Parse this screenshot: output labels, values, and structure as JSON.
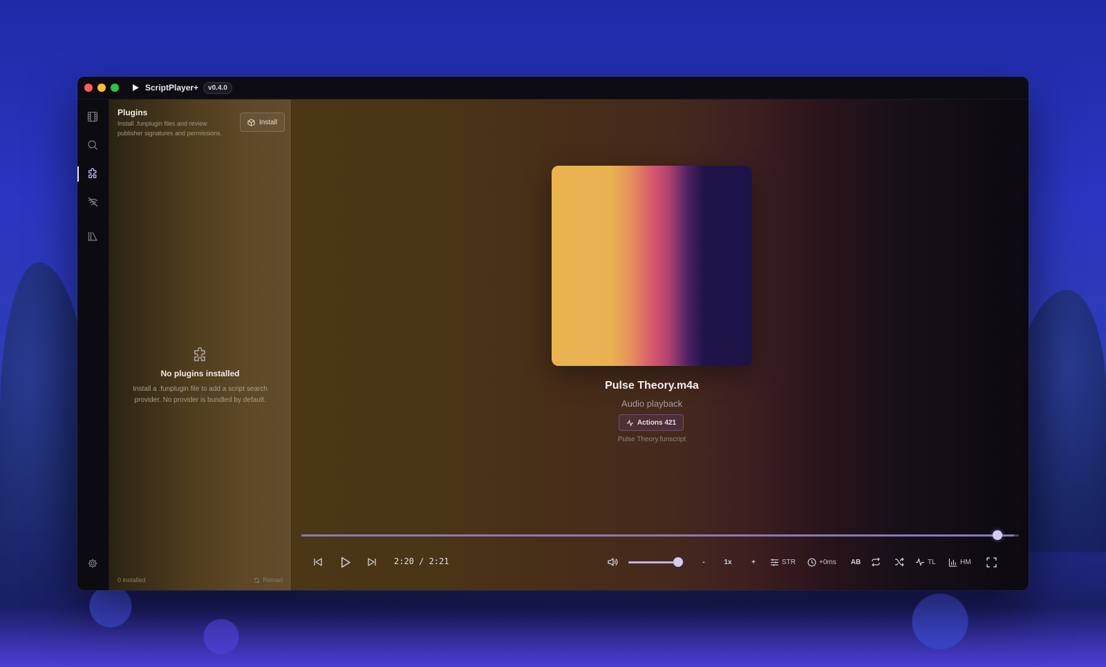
{
  "app": {
    "name": "ScriptPlayer+",
    "version": "v0.4.0"
  },
  "rail": {
    "items": [
      {
        "icon": "film-icon",
        "active": false
      },
      {
        "icon": "search-icon",
        "active": false
      },
      {
        "icon": "puzzle-icon",
        "active": true
      },
      {
        "icon": "wifi-off-icon",
        "active": false
      },
      {
        "icon": "library-icon",
        "active": false
      }
    ],
    "settings_icon": "gear-icon"
  },
  "plugins": {
    "title": "Plugins",
    "description": "Install .funplugin files and review publisher signatures and permissions.",
    "install_label": "Install",
    "empty_title": "No plugins installed",
    "empty_description": "Install a .funplugin file to add a script search provider. No provider is bundled by default.",
    "installed_count": "0 installed",
    "reload_label": "Reload"
  },
  "player": {
    "track_title": "Pulse Theory.m4a",
    "track_subtitle": "Audio playback",
    "actions_label": "Actions 421",
    "script_name": "Pulse Theory.funscript",
    "time": "2:20 / 2:21",
    "progress": 0.993,
    "volume": 0.9,
    "speed_minus": "-",
    "speed": "1x",
    "speed_plus": "+",
    "stroke_label": "STR",
    "offset_label": "+0ms",
    "ab_label": "AB",
    "timeline_label": "TL",
    "heatmap_label": "HM"
  },
  "colors": {
    "accent": "#b9a7ff",
    "thumb": "#d6cbf5"
  }
}
